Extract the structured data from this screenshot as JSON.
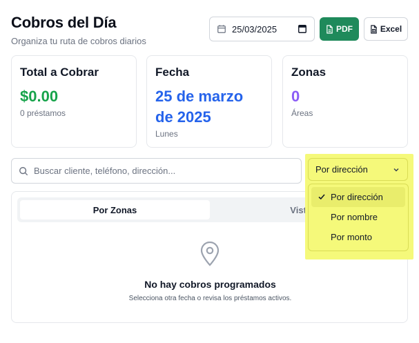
{
  "header": {
    "title": "Cobros del Día",
    "subtitle": "Organiza tu ruta de cobros diarios"
  },
  "date_picker": {
    "value": "25/03/2025"
  },
  "buttons": {
    "pdf": "PDF",
    "excel": "Excel"
  },
  "cards": [
    {
      "title": "Total a Cobrar",
      "value": "$0.00",
      "sub": "0 préstamos",
      "color": "#16a34a"
    },
    {
      "title": "Fecha",
      "value": "25 de marzo de 2025",
      "sub": "Lunes",
      "color": "#2563eb"
    },
    {
      "title": "Zonas",
      "value": "0",
      "sub": "Áreas",
      "color": "#8b5cf6"
    }
  ],
  "search": {
    "placeholder": "Buscar cliente, teléfono, dirección..."
  },
  "sort_select": {
    "selected": "Por dirección",
    "options": [
      "Por dirección",
      "Por nombre",
      "Por monto"
    ]
  },
  "tabs": [
    "Por Zonas",
    "Vista d"
  ],
  "empty_state": {
    "title": "No hay cobros programados",
    "subtitle": "Selecciona otra fecha o revisa los préstamos activos."
  },
  "colors": {
    "accent_green": "#1f8a5b",
    "highlight": "#f5f97a"
  }
}
